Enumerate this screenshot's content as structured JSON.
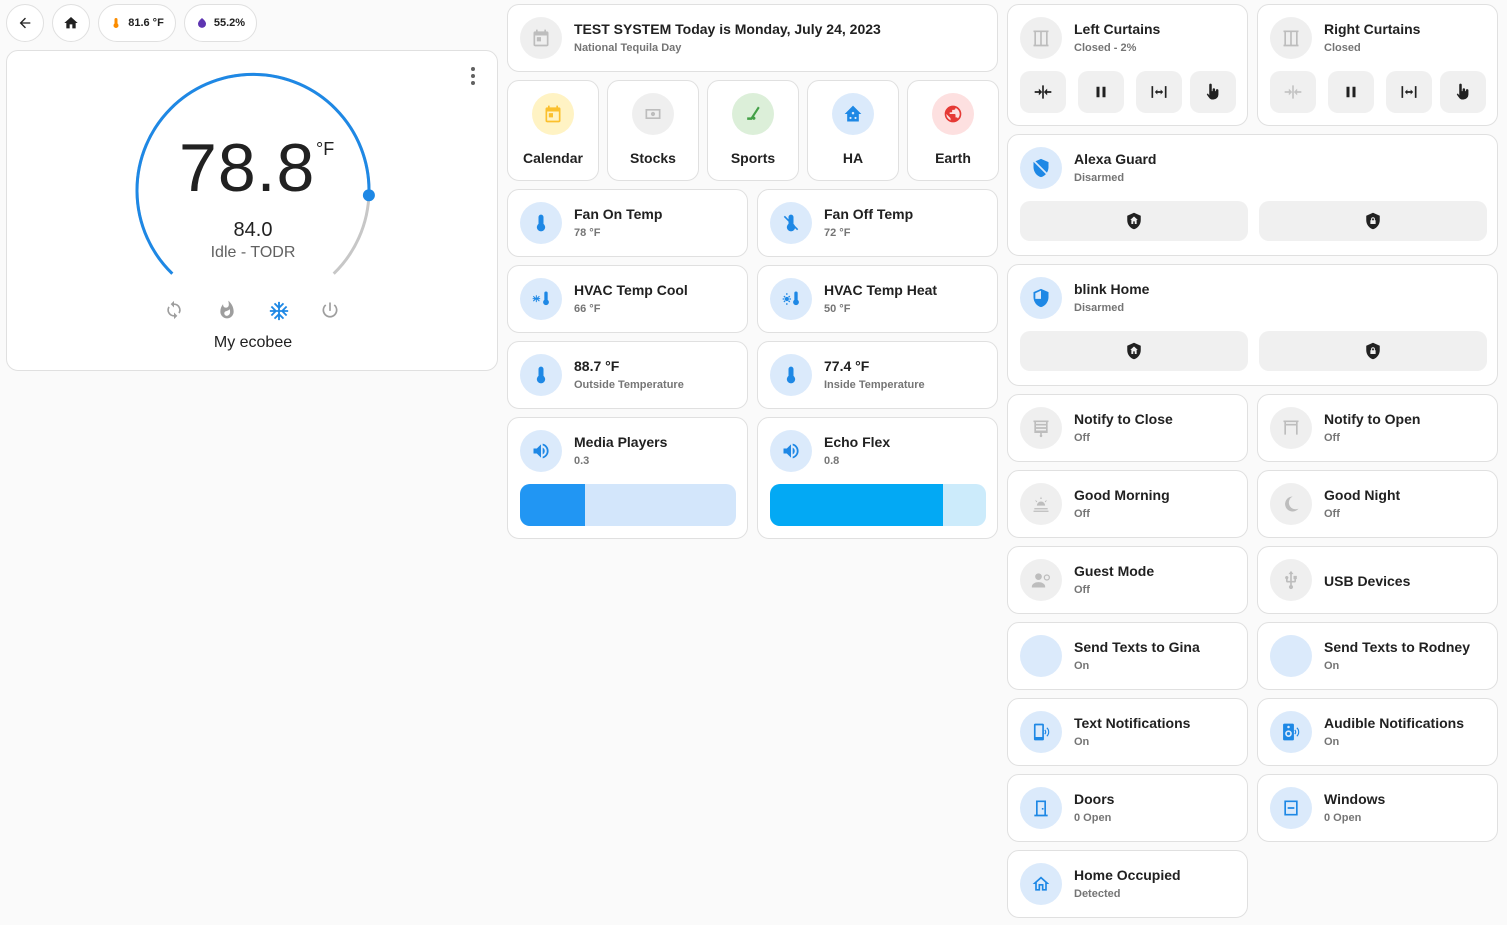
{
  "header": {
    "outdoor_temp": "81.6 °F",
    "humidity": "55.2%"
  },
  "thermostat": {
    "current": "78.8",
    "unit": "°F",
    "target": "84.0",
    "status": "Idle - TODR",
    "name": "My ecobee",
    "modes": [
      "auto-mode-icon",
      "heat-mode-icon",
      "cool-mode-icon",
      "power-icon"
    ],
    "active_mode": "cool",
    "arc_level": 0.84
  },
  "calendar": {
    "title": "TEST SYSTEM Today is Monday, July 24, 2023",
    "subtitle": "National Tequila Day"
  },
  "shortcuts": [
    {
      "label": "Calendar",
      "icon": "calendar-icon"
    },
    {
      "label": "Stocks",
      "icon": "cash-icon"
    },
    {
      "label": "Sports",
      "icon": "hockey-stick-icon"
    },
    {
      "label": "HA",
      "icon": "home-assistant-icon"
    },
    {
      "label": "Earth",
      "icon": "globe-icon"
    }
  ],
  "middle_tiles": {
    "fan_on": {
      "name": "Fan On Temp",
      "state": "78 °F"
    },
    "fan_off": {
      "name": "Fan Off Temp",
      "state": "72 °F"
    },
    "hvac_cool": {
      "name": "HVAC Temp Cool",
      "state": "66 °F"
    },
    "hvac_heat": {
      "name": "HVAC Temp Heat",
      "state": "50 °F"
    },
    "outside": {
      "name": "88.7 °F",
      "state": "Outside Temperature"
    },
    "inside": {
      "name": "77.4 °F",
      "state": "Inside Temperature"
    },
    "media": {
      "name": "Media Players",
      "state": "0.3",
      "level": 0.3
    },
    "echo": {
      "name": "Echo Flex",
      "state": "0.8",
      "level": 0.8
    }
  },
  "curtains": {
    "left": {
      "name": "Left Curtains",
      "state": "Closed - 2%"
    },
    "right": {
      "name": "Right Curtains",
      "state": "Closed"
    }
  },
  "alarms": {
    "alexa": {
      "name": "Alexa Guard",
      "state": "Disarmed"
    },
    "blink": {
      "name": "blink Home",
      "state": "Disarmed"
    }
  },
  "right_tiles": {
    "notify_close": {
      "name": "Notify to Close",
      "state": "Off"
    },
    "notify_open": {
      "name": "Notify to Open",
      "state": "Off"
    },
    "good_morning": {
      "name": "Good Morning",
      "state": "Off"
    },
    "good_night": {
      "name": "Good Night",
      "state": "Off"
    },
    "guest_mode": {
      "name": "Guest Mode",
      "state": "Off"
    },
    "usb": {
      "name": "USB Devices"
    },
    "texts_gina": {
      "name": "Send Texts to Gina",
      "state": "On"
    },
    "texts_rodney": {
      "name": "Send Texts to Rodney",
      "state": "On"
    },
    "text_notif": {
      "name": "Text Notifications",
      "state": "On"
    },
    "audible_notif": {
      "name": "Audible Notifications",
      "state": "On"
    },
    "doors": {
      "name": "Doors",
      "state": "0 Open"
    },
    "windows": {
      "name": "Windows",
      "state": "0 Open"
    },
    "home_occupied": {
      "name": "Home Occupied",
      "state": "Detected"
    }
  },
  "colors": {
    "accent": "#1e88e5",
    "slider_fill_media": "#2196f3",
    "slider_fill_echo": "#03a9f4"
  }
}
